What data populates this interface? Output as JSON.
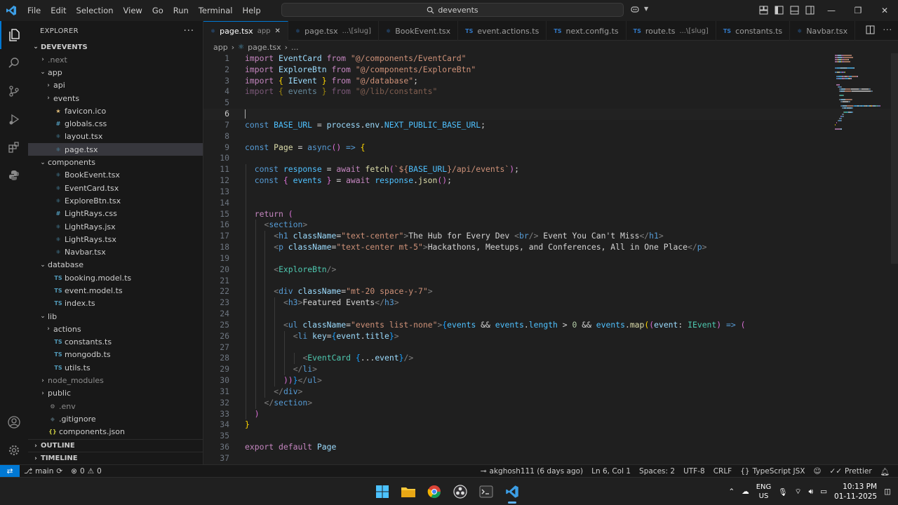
{
  "menu": [
    "File",
    "Edit",
    "Selection",
    "View",
    "Go",
    "Run",
    "Terminal",
    "Help"
  ],
  "search": {
    "text": "devevents"
  },
  "explorer": {
    "title": "EXPLORER",
    "root": "DEVEVENTS",
    "items": [
      {
        "label": ".next",
        "depth": 1,
        "kind": "folder",
        "open": false,
        "icon": "",
        "color": "",
        "dim": true
      },
      {
        "label": "app",
        "depth": 1,
        "kind": "folder",
        "open": true,
        "icon": "",
        "color": ""
      },
      {
        "label": "api",
        "depth": 2,
        "kind": "folder",
        "open": false,
        "icon": "",
        "color": ""
      },
      {
        "label": "events",
        "depth": 2,
        "kind": "folder",
        "open": false,
        "icon": "",
        "color": ""
      },
      {
        "label": "favicon.ico",
        "depth": 2,
        "kind": "file",
        "icon": "★",
        "color": "#e5c07b"
      },
      {
        "label": "globals.css",
        "depth": 2,
        "kind": "file",
        "icon": "#",
        "color": "#519aba"
      },
      {
        "label": "layout.tsx",
        "depth": 2,
        "kind": "file",
        "icon": "⚛",
        "color": "#519aba"
      },
      {
        "label": "page.tsx",
        "depth": 2,
        "kind": "file",
        "icon": "⚛",
        "color": "#519aba",
        "selected": true
      },
      {
        "label": "components",
        "depth": 1,
        "kind": "folder",
        "open": true,
        "icon": "",
        "color": ""
      },
      {
        "label": "BookEvent.tsx",
        "depth": 2,
        "kind": "file",
        "icon": "⚛",
        "color": "#519aba"
      },
      {
        "label": "EventCard.tsx",
        "depth": 2,
        "kind": "file",
        "icon": "⚛",
        "color": "#519aba"
      },
      {
        "label": "ExploreBtn.tsx",
        "depth": 2,
        "kind": "file",
        "icon": "⚛",
        "color": "#519aba"
      },
      {
        "label": "LightRays.css",
        "depth": 2,
        "kind": "file",
        "icon": "#",
        "color": "#519aba"
      },
      {
        "label": "LightRays.jsx",
        "depth": 2,
        "kind": "file",
        "icon": "⚛",
        "color": "#519aba"
      },
      {
        "label": "LightRays.tsx",
        "depth": 2,
        "kind": "file",
        "icon": "⚛",
        "color": "#519aba"
      },
      {
        "label": "Navbar.tsx",
        "depth": 2,
        "kind": "file",
        "icon": "⚛",
        "color": "#519aba"
      },
      {
        "label": "database",
        "depth": 1,
        "kind": "folder",
        "open": true,
        "icon": "",
        "color": ""
      },
      {
        "label": "booking.model.ts",
        "depth": 2,
        "kind": "file",
        "icon": "TS",
        "color": "#519aba"
      },
      {
        "label": "event.model.ts",
        "depth": 2,
        "kind": "file",
        "icon": "TS",
        "color": "#519aba"
      },
      {
        "label": "index.ts",
        "depth": 2,
        "kind": "file",
        "icon": "TS",
        "color": "#519aba"
      },
      {
        "label": "lib",
        "depth": 1,
        "kind": "folder",
        "open": true,
        "icon": "",
        "color": ""
      },
      {
        "label": "actions",
        "depth": 2,
        "kind": "folder",
        "open": false,
        "icon": "",
        "color": ""
      },
      {
        "label": "constants.ts",
        "depth": 2,
        "kind": "file",
        "icon": "TS",
        "color": "#519aba"
      },
      {
        "label": "mongodb.ts",
        "depth": 2,
        "kind": "file",
        "icon": "TS",
        "color": "#519aba"
      },
      {
        "label": "utils.ts",
        "depth": 2,
        "kind": "file",
        "icon": "TS",
        "color": "#519aba"
      },
      {
        "label": "node_modules",
        "depth": 1,
        "kind": "folder",
        "open": false,
        "icon": "",
        "color": "",
        "dim": true
      },
      {
        "label": "public",
        "depth": 1,
        "kind": "folder",
        "open": false,
        "icon": "",
        "color": ""
      },
      {
        "label": ".env",
        "depth": 1,
        "kind": "file",
        "icon": "⚙",
        "color": "#8b8b8b",
        "dim": true
      },
      {
        "label": ".gitignore",
        "depth": 1,
        "kind": "file",
        "icon": "◆",
        "color": "#41535b"
      },
      {
        "label": "components.json",
        "depth": 1,
        "kind": "file",
        "icon": "{}",
        "color": "#cbcb41"
      }
    ],
    "outline": "OUTLINE",
    "timeline": "TIMELINE"
  },
  "tabs": [
    {
      "label": "page.tsx",
      "desc": "app",
      "icon": "⚛",
      "active": true
    },
    {
      "label": "page.tsx",
      "desc": "...\\[slug]",
      "icon": "⚛"
    },
    {
      "label": "BookEvent.tsx",
      "desc": "",
      "icon": "⚛"
    },
    {
      "label": "event.actions.ts",
      "desc": "",
      "icon": "TS"
    },
    {
      "label": "next.config.ts",
      "desc": "",
      "icon": "TS"
    },
    {
      "label": "route.ts",
      "desc": "...\\[slug]",
      "icon": "TS"
    },
    {
      "label": "constants.ts",
      "desc": "",
      "icon": "TS"
    },
    {
      "label": "Navbar.tsx",
      "desc": "",
      "icon": "⚛"
    }
  ],
  "breadcrumb": [
    "app",
    "page.tsx",
    "..."
  ],
  "editor": {
    "current_line": 6,
    "lines": [
      {
        "n": 1,
        "ind": 0,
        "t": [
          [
            "import ",
            "t-kw"
          ],
          [
            "EventCard ",
            "t-id"
          ],
          [
            "from ",
            "t-kw"
          ],
          [
            "\"@/components/EventCard\"",
            "t-str"
          ]
        ]
      },
      {
        "n": 2,
        "ind": 0,
        "t": [
          [
            "import ",
            "t-kw"
          ],
          [
            "ExploreBtn ",
            "t-id"
          ],
          [
            "from ",
            "t-kw"
          ],
          [
            "\"@/components/ExploreBtn\"",
            "t-str"
          ]
        ]
      },
      {
        "n": 3,
        "ind": 0,
        "t": [
          [
            "import ",
            "t-kw"
          ],
          [
            "{ ",
            "t-br1"
          ],
          [
            "IEvent ",
            "t-id"
          ],
          [
            "} ",
            "t-br1"
          ],
          [
            "from ",
            "t-kw"
          ],
          [
            "\"@/database\"",
            "t-str"
          ],
          [
            ";",
            "t-txt"
          ]
        ]
      },
      {
        "n": 4,
        "ind": 0,
        "faded": true,
        "t": [
          [
            "import ",
            "t-kw"
          ],
          [
            "{ ",
            "t-br1"
          ],
          [
            "events ",
            "t-id"
          ],
          [
            "} ",
            "t-br1"
          ],
          [
            "from ",
            "t-kw"
          ],
          [
            "\"@/lib/constants\"",
            "t-str"
          ]
        ]
      },
      {
        "n": 5,
        "ind": 0,
        "t": []
      },
      {
        "n": 6,
        "ind": 0,
        "t": []
      },
      {
        "n": 7,
        "ind": 0,
        "t": [
          [
            "const ",
            "t-kw2"
          ],
          [
            "BASE_URL ",
            "t-const"
          ],
          [
            "= ",
            "t-txt"
          ],
          [
            "process",
            "t-id"
          ],
          [
            ".",
            "t-txt"
          ],
          [
            "env",
            "t-id"
          ],
          [
            ".",
            "t-txt"
          ],
          [
            "NEXT_PUBLIC_BASE_URL",
            "t-const"
          ],
          [
            ";",
            "t-txt"
          ]
        ]
      },
      {
        "n": 8,
        "ind": 0,
        "t": []
      },
      {
        "n": 9,
        "ind": 0,
        "t": [
          [
            "const ",
            "t-kw2"
          ],
          [
            "Page ",
            "t-fn"
          ],
          [
            "= ",
            "t-txt"
          ],
          [
            "async",
            "t-kw2"
          ],
          [
            "() ",
            "t-br2"
          ],
          [
            "=> ",
            "t-kw2"
          ],
          [
            "{",
            "t-br1"
          ]
        ]
      },
      {
        "n": 10,
        "ind": 0,
        "t": []
      },
      {
        "n": 11,
        "ind": 1,
        "t": [
          [
            "const ",
            "t-kw2"
          ],
          [
            "response ",
            "t-const"
          ],
          [
            "= ",
            "t-txt"
          ],
          [
            "await ",
            "t-kw"
          ],
          [
            "fetch",
            "t-fn"
          ],
          [
            "(",
            "t-br2"
          ],
          [
            "`${",
            "t-str"
          ],
          [
            "BASE_URL",
            "t-const"
          ],
          [
            "}",
            "t-str"
          ],
          [
            "/api/events`",
            "t-str"
          ],
          [
            ")",
            "t-br2"
          ],
          [
            ";",
            "t-txt"
          ]
        ]
      },
      {
        "n": 12,
        "ind": 1,
        "t": [
          [
            "const ",
            "t-kw2"
          ],
          [
            "{ ",
            "t-br2"
          ],
          [
            "events ",
            "t-const"
          ],
          [
            "} ",
            "t-br2"
          ],
          [
            "= ",
            "t-txt"
          ],
          [
            "await ",
            "t-kw"
          ],
          [
            "response",
            "t-const"
          ],
          [
            ".",
            "t-txt"
          ],
          [
            "json",
            "t-fn"
          ],
          [
            "()",
            "t-br2"
          ],
          [
            ";",
            "t-txt"
          ]
        ]
      },
      {
        "n": 13,
        "ind": 1,
        "t": []
      },
      {
        "n": 14,
        "ind": 1,
        "t": []
      },
      {
        "n": 15,
        "ind": 1,
        "t": [
          [
            "return ",
            "t-kw"
          ],
          [
            "(",
            "t-br2"
          ]
        ]
      },
      {
        "n": 16,
        "ind": 2,
        "t": [
          [
            "<",
            "t-pun"
          ],
          [
            "section",
            "t-tag"
          ],
          [
            ">",
            "t-pun"
          ]
        ]
      },
      {
        "n": 17,
        "ind": 3,
        "t": [
          [
            "<",
            "t-pun"
          ],
          [
            "h1 ",
            "t-tag"
          ],
          [
            "className",
            "t-attr"
          ],
          [
            "=",
            "t-txt"
          ],
          [
            "\"text-center\"",
            "t-str"
          ],
          [
            ">",
            "t-pun"
          ],
          [
            "The Hub for Every Dev ",
            "t-txt"
          ],
          [
            "<",
            "t-pun"
          ],
          [
            "br",
            "t-tag"
          ],
          [
            "/> ",
            "t-pun"
          ],
          [
            "Event You Can't Miss",
            "t-txt"
          ],
          [
            "</",
            "t-pun"
          ],
          [
            "h1",
            "t-tag"
          ],
          [
            ">",
            "t-pun"
          ]
        ]
      },
      {
        "n": 18,
        "ind": 3,
        "t": [
          [
            "<",
            "t-pun"
          ],
          [
            "p ",
            "t-tag"
          ],
          [
            "className",
            "t-attr"
          ],
          [
            "=",
            "t-txt"
          ],
          [
            "\"text-center mt-5\"",
            "t-str"
          ],
          [
            ">",
            "t-pun"
          ],
          [
            "Hackathons, Meetups, and Conferences, All in One Place",
            "t-txt"
          ],
          [
            "</",
            "t-pun"
          ],
          [
            "p",
            "t-tag"
          ],
          [
            ">",
            "t-pun"
          ]
        ]
      },
      {
        "n": 19,
        "ind": 3,
        "t": []
      },
      {
        "n": 20,
        "ind": 3,
        "t": [
          [
            "<",
            "t-pun"
          ],
          [
            "ExploreBtn",
            "t-comp"
          ],
          [
            "/>",
            "t-pun"
          ]
        ]
      },
      {
        "n": 21,
        "ind": 3,
        "t": []
      },
      {
        "n": 22,
        "ind": 3,
        "t": [
          [
            "<",
            "t-pun"
          ],
          [
            "div ",
            "t-tag"
          ],
          [
            "className",
            "t-attr"
          ],
          [
            "=",
            "t-txt"
          ],
          [
            "\"mt-20 space-y-7\"",
            "t-str"
          ],
          [
            ">",
            "t-pun"
          ]
        ]
      },
      {
        "n": 23,
        "ind": 4,
        "t": [
          [
            "<",
            "t-pun"
          ],
          [
            "h3",
            "t-tag"
          ],
          [
            ">",
            "t-pun"
          ],
          [
            "Featured Events",
            "t-txt"
          ],
          [
            "</",
            "t-pun"
          ],
          [
            "h3",
            "t-tag"
          ],
          [
            ">",
            "t-pun"
          ]
        ]
      },
      {
        "n": 24,
        "ind": 4,
        "t": []
      },
      {
        "n": 25,
        "ind": 4,
        "t": [
          [
            "<",
            "t-pun"
          ],
          [
            "ul ",
            "t-tag"
          ],
          [
            "className",
            "t-attr"
          ],
          [
            "=",
            "t-txt"
          ],
          [
            "\"events list-none\"",
            "t-str"
          ],
          [
            ">",
            "t-pun"
          ],
          [
            "{",
            "t-br3"
          ],
          [
            "events ",
            "t-const"
          ],
          [
            "&& ",
            "t-txt"
          ],
          [
            "events",
            "t-const"
          ],
          [
            ".",
            "t-txt"
          ],
          [
            "length ",
            "t-const"
          ],
          [
            "> ",
            "t-txt"
          ],
          [
            "0 ",
            "t-num"
          ],
          [
            "&& ",
            "t-txt"
          ],
          [
            "events",
            "t-const"
          ],
          [
            ".",
            "t-txt"
          ],
          [
            "map",
            "t-fn"
          ],
          [
            "(",
            "t-br1"
          ],
          [
            "(",
            "t-br2"
          ],
          [
            "event",
            "t-id"
          ],
          [
            ": ",
            "t-txt"
          ],
          [
            "IEvent",
            "t-comp"
          ],
          [
            ") ",
            "t-br2"
          ],
          [
            "=> ",
            "t-kw2"
          ],
          [
            "(",
            "t-br2"
          ]
        ]
      },
      {
        "n": 26,
        "ind": 5,
        "t": [
          [
            "<",
            "t-pun"
          ],
          [
            "li ",
            "t-tag"
          ],
          [
            "key",
            "t-attr"
          ],
          [
            "=",
            "t-txt"
          ],
          [
            "{",
            "t-br3"
          ],
          [
            "event",
            "t-id"
          ],
          [
            ".",
            "t-txt"
          ],
          [
            "title",
            "t-id"
          ],
          [
            "}",
            "t-br3"
          ],
          [
            ">",
            "t-pun"
          ]
        ]
      },
      {
        "n": 27,
        "ind": 5,
        "t": []
      },
      {
        "n": 28,
        "ind": 6,
        "t": [
          [
            "<",
            "t-pun"
          ],
          [
            "EventCard ",
            "t-comp"
          ],
          [
            "{",
            "t-br3"
          ],
          [
            "...",
            "t-txt"
          ],
          [
            "event",
            "t-id"
          ],
          [
            "}",
            "t-br3"
          ],
          [
            "/>",
            "t-pun"
          ]
        ]
      },
      {
        "n": 29,
        "ind": 5,
        "t": [
          [
            "</",
            "t-pun"
          ],
          [
            "li",
            "t-tag"
          ],
          [
            ">",
            "t-pun"
          ]
        ]
      },
      {
        "n": 30,
        "ind": 4,
        "t": [
          [
            "))",
            "t-br2"
          ],
          [
            "}",
            "t-br3"
          ],
          [
            "</",
            "t-pun"
          ],
          [
            "ul",
            "t-tag"
          ],
          [
            ">",
            "t-pun"
          ]
        ]
      },
      {
        "n": 31,
        "ind": 3,
        "t": [
          [
            "</",
            "t-pun"
          ],
          [
            "div",
            "t-tag"
          ],
          [
            ">",
            "t-pun"
          ]
        ]
      },
      {
        "n": 32,
        "ind": 2,
        "t": [
          [
            "</",
            "t-pun"
          ],
          [
            "section",
            "t-tag"
          ],
          [
            ">",
            "t-pun"
          ]
        ]
      },
      {
        "n": 33,
        "ind": 1,
        "t": [
          [
            ")",
            "t-br2"
          ]
        ]
      },
      {
        "n": 34,
        "ind": 0,
        "t": [
          [
            "}",
            "t-br1"
          ]
        ]
      },
      {
        "n": 35,
        "ind": 0,
        "t": []
      },
      {
        "n": 36,
        "ind": 0,
        "t": [
          [
            "export ",
            "t-kw"
          ],
          [
            "default ",
            "t-kw"
          ],
          [
            "Page",
            "t-id"
          ]
        ]
      },
      {
        "n": 37,
        "ind": 0,
        "t": []
      }
    ]
  },
  "status": {
    "branch": "main",
    "errors": "0",
    "warnings": "0",
    "blame": "akghosh111 (6 days ago)",
    "position": "Ln 6, Col 1",
    "spaces": "Spaces: 2",
    "encoding": "UTF-8",
    "eol": "CRLF",
    "language": "TypeScript JSX",
    "formatter": "Prettier"
  },
  "taskbar": {
    "lang_line1": "ENG",
    "lang_line2": "US",
    "time": "10:13 PM",
    "date": "01-11-2025"
  },
  "colors": {
    "accent": "#0078d4",
    "editor_bg": "#1f1f1f",
    "sidebar_bg": "#181818"
  }
}
